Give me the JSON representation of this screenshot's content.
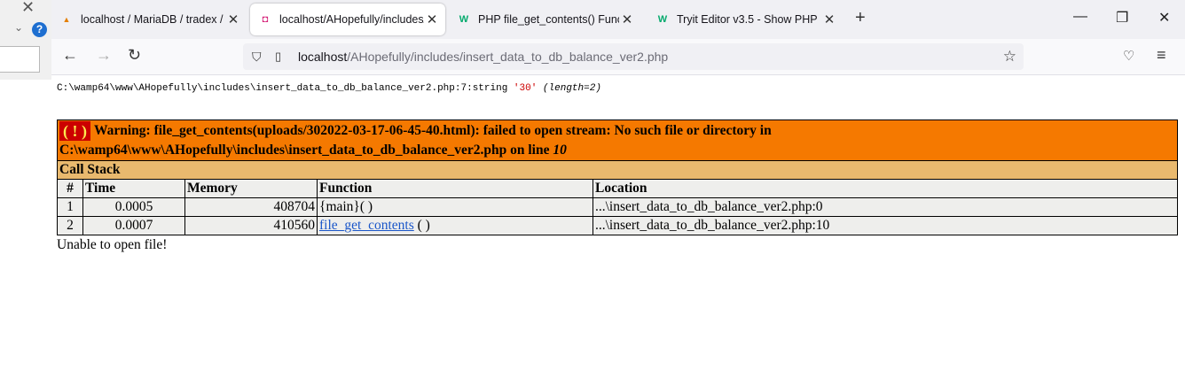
{
  "left_window": {
    "help_glyph": "?"
  },
  "tabs": [
    {
      "title": "localhost / MariaDB / tradex / u",
      "favicon": "pma-icon",
      "active": false
    },
    {
      "title": "localhost/AHopefully/includes/",
      "favicon": "wamp-icon",
      "active": true
    },
    {
      "title": "PHP file_get_contents() Functio",
      "favicon": "w3schools-icon",
      "active": false
    },
    {
      "title": "Tryit Editor v3.5 - Show PHP",
      "favicon": "w3schools-icon",
      "active": false
    }
  ],
  "address": {
    "host": "localhost",
    "path": "/AHopefully/includes/insert_data_to_db_balance_ver2.php"
  },
  "var_dump": {
    "location": "C:\\wamp64\\www\\AHopefully\\includes\\insert_data_to_db_balance_ver2.php:7:",
    "type": "string",
    "value": "'30'",
    "length": "(length=2)"
  },
  "warning": {
    "badge": "( ! )",
    "text": "Warning: file_get_contents(uploads/302022-03-17-06-45-40.html): failed to open stream: No such file or directory in C:\\wamp64\\www\\AHopefully\\includes\\insert_data_to_db_balance_ver2.php on line",
    "line": "10"
  },
  "call_stack": {
    "title": "Call Stack",
    "headers": [
      "#",
      "Time",
      "Memory",
      "Function",
      "Location"
    ],
    "rows": [
      {
        "num": "1",
        "time": "0.0005",
        "memory": "408704",
        "function": "{main}( )",
        "location": "...\\insert_data_to_db_balance_ver2.php:0"
      },
      {
        "num": "2",
        "time": "0.0007",
        "memory": "410560",
        "function": "file_get_contents",
        "function_suffix": " ( )",
        "location": "...\\insert_data_to_db_balance_ver2.php:10"
      }
    ]
  },
  "message": "Unable to open file!"
}
